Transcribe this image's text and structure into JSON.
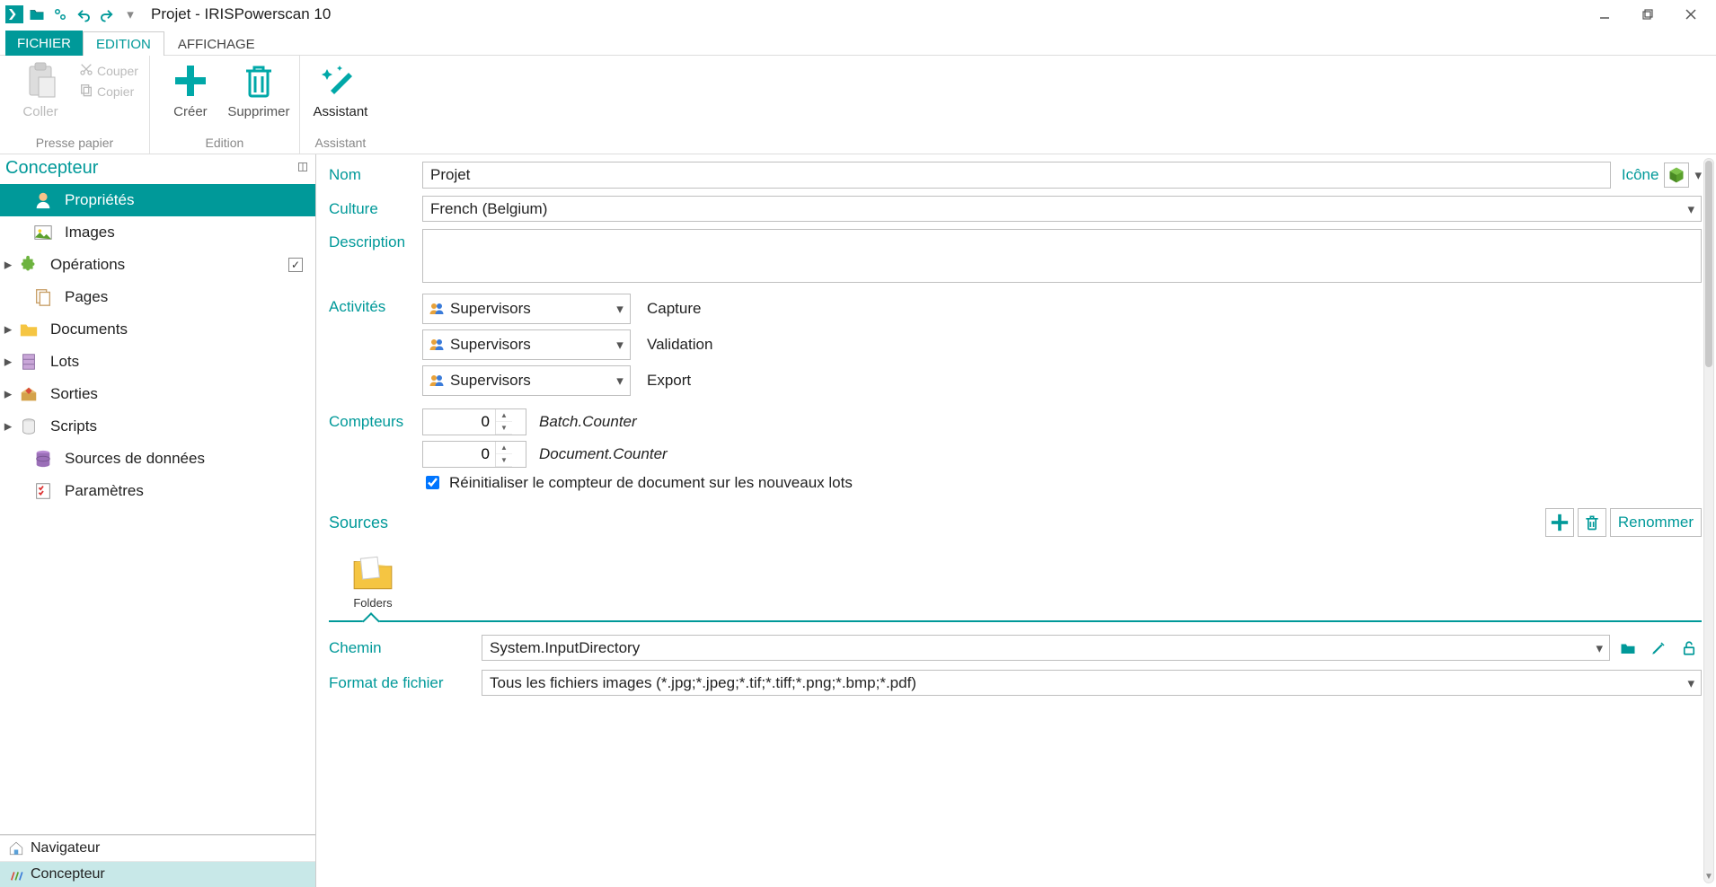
{
  "title": "Projet - IRISPowerscan 10",
  "ribbon_tabs": {
    "file": "FICHIER",
    "edition": "EDITION",
    "display": "AFFICHAGE"
  },
  "ribbon": {
    "clipboard": {
      "paste": "Coller",
      "cut": "Couper",
      "copy": "Copier",
      "group": "Presse papier"
    },
    "edition": {
      "create": "Créer",
      "delete": "Supprimer",
      "group": "Edition"
    },
    "assistant": {
      "assistant": "Assistant",
      "group": "Assistant"
    }
  },
  "sidebar": {
    "title": "Concepteur",
    "items": [
      {
        "label": "Propriétés"
      },
      {
        "label": "Images"
      },
      {
        "label": "Opérations"
      },
      {
        "label": "Pages"
      },
      {
        "label": "Documents"
      },
      {
        "label": "Lots"
      },
      {
        "label": "Sorties"
      },
      {
        "label": "Scripts"
      },
      {
        "label": "Sources de données"
      },
      {
        "label": "Paramètres"
      }
    ],
    "bottom": {
      "navigator": "Navigateur",
      "designer": "Concepteur"
    }
  },
  "form": {
    "name_label": "Nom",
    "name_value": "Projet",
    "icon_label": "Icône",
    "culture_label": "Culture",
    "culture_value": "French (Belgium)",
    "description_label": "Description",
    "description_value": "",
    "activities_label": "Activités",
    "activities": [
      {
        "group": "Supervisors",
        "name": "Capture"
      },
      {
        "group": "Supervisors",
        "name": "Validation"
      },
      {
        "group": "Supervisors",
        "name": "Export"
      }
    ],
    "counters_label": "Compteurs",
    "counters": [
      {
        "value": "0",
        "name": "Batch.Counter"
      },
      {
        "value": "0",
        "name": "Document.Counter"
      }
    ],
    "reset_label": "Réinitialiser le compteur de document sur les nouveaux lots",
    "sources_label": "Sources",
    "rename_label": "Renommer",
    "source_item": "Folders",
    "path_label": "Chemin",
    "path_value": "System.InputDirectory",
    "format_label": "Format de fichier",
    "format_value": "Tous les fichiers images (*.jpg;*.jpeg;*.tif;*.tiff;*.png;*.bmp;*.pdf)"
  }
}
